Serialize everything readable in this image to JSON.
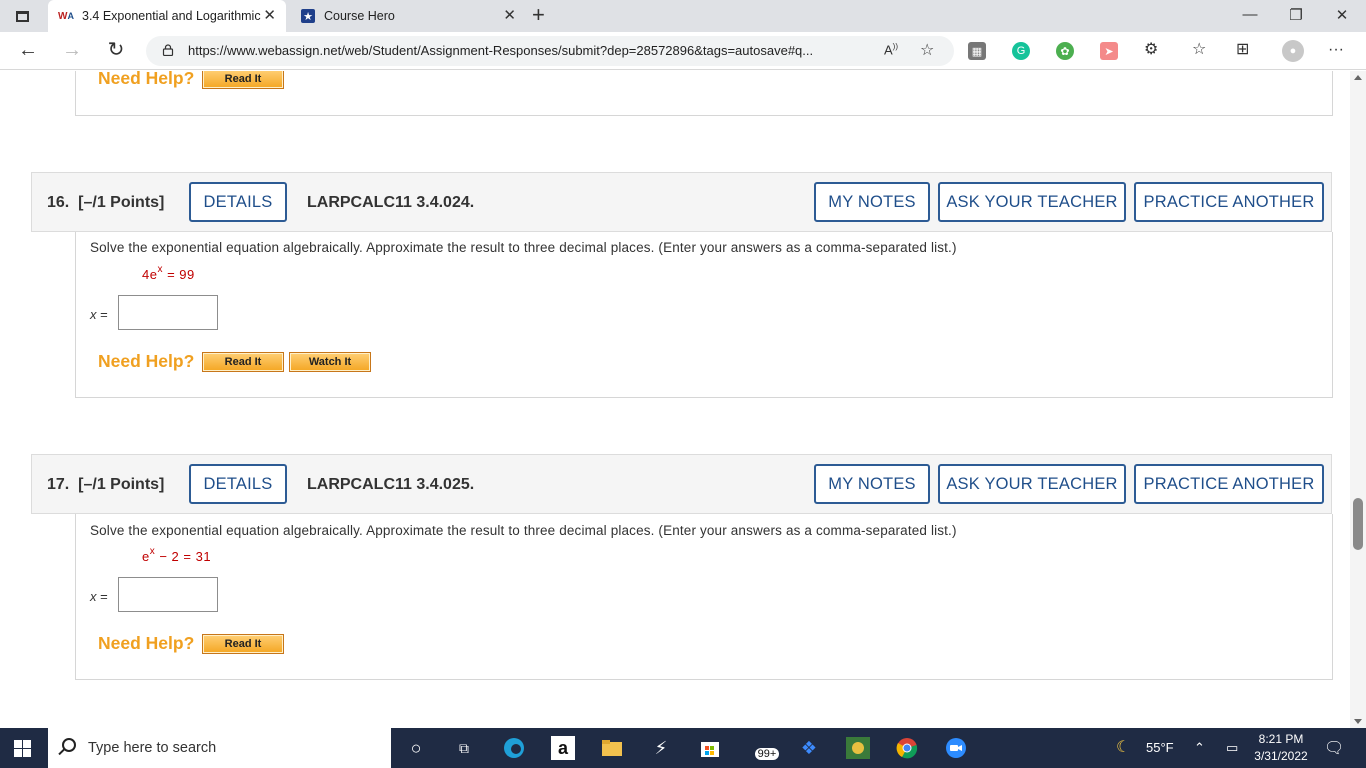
{
  "browser": {
    "tabs": [
      {
        "label": "3.4 Exponential and Logarithmic",
        "favicon": "WA",
        "active": true
      },
      {
        "label": "Course Hero",
        "favicon": "star-shield",
        "active": false
      }
    ],
    "url": "https://www.webassign.net/web/Student/Assignment-Responses/submit?dep=28572896&tags=autosave#q..."
  },
  "previous": {
    "need_help": "Need Help?",
    "read_it": "Read It"
  },
  "questions": [
    {
      "number": "16.",
      "points": "[–/1 Points]",
      "details": "DETAILS",
      "code": "LARPCALC11 3.4.024.",
      "my_notes": "MY NOTES",
      "ask_teacher": "ASK YOUR TEACHER",
      "practice": "PRACTICE ANOTHER",
      "instruction": "Solve the exponential equation algebraically. Approximate the result to three decimal places. (Enter your answers as a comma-separated list.)",
      "eq_prefix": "4e",
      "eq_exp": "x",
      "eq_suffix": " = 99",
      "x_label": "x",
      "answer_value": "",
      "need_help": "Need Help?",
      "read_it": "Read It",
      "watch_it": "Watch It"
    },
    {
      "number": "17.",
      "points": "[–/1 Points]",
      "details": "DETAILS",
      "code": "LARPCALC11 3.4.025.",
      "my_notes": "MY NOTES",
      "ask_teacher": "ASK YOUR TEACHER",
      "practice": "PRACTICE ANOTHER",
      "instruction": "Solve the exponential equation algebraically. Approximate the result to three decimal places. (Enter your answers as a comma-separated list.)",
      "eq_prefix": "e",
      "eq_exp": "x",
      "eq_suffix": " − 2 = 31",
      "x_label": "x",
      "answer_value": "",
      "need_help": "Need Help?",
      "read_it": "Read It"
    }
  ],
  "taskbar": {
    "search_placeholder": "Type here to search",
    "badge": "99+",
    "weather": "55°F",
    "time": "8:21 PM",
    "date": "3/31/2022"
  },
  "colors": {
    "accent_blue": "#1f4e8a",
    "help_orange": "#f0a020",
    "equation_red": "#c00000",
    "taskbar": "#1f2b44"
  }
}
